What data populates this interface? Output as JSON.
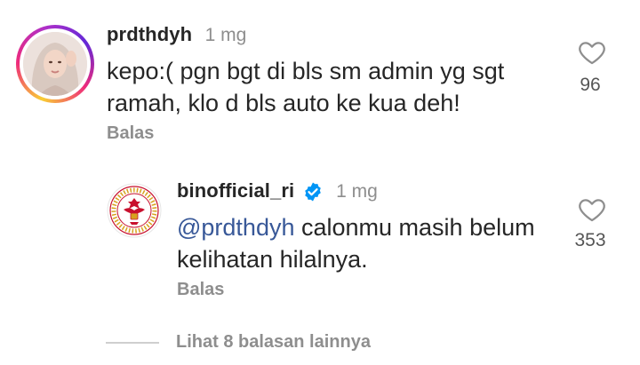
{
  "comments": [
    {
      "username": "prdthdyh",
      "time": "1 mg",
      "text": "kepo:( pgn  bgt di bls sm admin yg sgt ramah, klo d bls auto ke kua deh!",
      "text_lines": [
        "kepo:( pgn  bgt di bls sm admin yg sgt",
        "ramah, klo d bls auto ke kua deh!"
      ],
      "reply_label": "Balas",
      "likes": "96",
      "avatar": "profile-photo"
    },
    {
      "username": "binofficial_ri",
      "verified": true,
      "time": "1 mg",
      "mention": "@prdthdyh",
      "text_line1_rest": " calonmu masih belum",
      "text_line2": "kelihatan hilalnya.",
      "reply_label": "Balas",
      "likes": "353",
      "avatar": "bin-seal-logo"
    }
  ],
  "view_more_replies": "Lihat 8 balasan lainnya",
  "icons": {
    "like": "heart-outline-icon",
    "verified": "verified-badge-icon"
  },
  "colors": {
    "text": "#262626",
    "muted": "#8e8e8e",
    "mention": "#385898",
    "verified": "#0095f6",
    "seal_red": "#c8102e"
  }
}
